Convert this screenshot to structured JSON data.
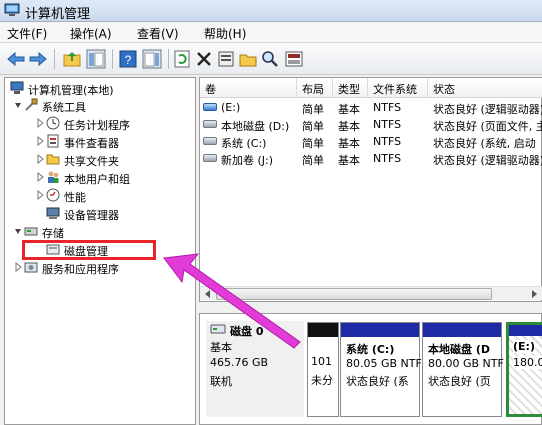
{
  "window": {
    "title": "计算机管理"
  },
  "menu": [
    "文件(F)",
    "操作(A)",
    "查看(V)",
    "帮助(H)"
  ],
  "toolbar": {
    "icons": [
      "back-icon",
      "forward-icon",
      "up-folder-icon",
      "show-tree-icon",
      "help-icon",
      "action-pane-icon",
      "refresh-icon",
      "delete-icon",
      "properties-icon",
      "open-icon",
      "search-icon",
      "disk-properties-icon"
    ]
  },
  "tree": {
    "root": "计算机管理(本地)",
    "system_tools": "系统工具",
    "task_scheduler": "任务计划程序",
    "event_viewer": "事件查看器",
    "shared_folders": "共享文件夹",
    "local_users": "本地用户和组",
    "performance": "性能",
    "device_manager": "设备管理器",
    "storage": "存储",
    "disk_management": "磁盘管理",
    "services_apps": "服务和应用程序"
  },
  "volumes": {
    "columns": [
      "卷",
      "布局",
      "类型",
      "文件系统",
      "状态"
    ],
    "rows": [
      {
        "volume": "(E:)",
        "layout": "简单",
        "type": "基本",
        "fs": "NTFS",
        "status": "状态良好 (逻辑驱动器)"
      },
      {
        "volume": "本地磁盘 (D:)",
        "layout": "简单",
        "type": "基本",
        "fs": "NTFS",
        "status": "状态良好 (页面文件, 主"
      },
      {
        "volume": "系统 (C:)",
        "layout": "简单",
        "type": "基本",
        "fs": "NTFS",
        "status": "状态良好 (系统, 启动"
      },
      {
        "volume": "新加卷 (J:)",
        "layout": "简单",
        "type": "基本",
        "fs": "NTFS",
        "status": "状态良好 (逻辑驱动器)"
      }
    ]
  },
  "disk": {
    "name": "磁盘 0",
    "type": "基本",
    "size": "465.76 GB",
    "state": "联机",
    "partitions": [
      {
        "line1": "101",
        "line2": "未分"
      },
      {
        "name": "系统 (C:)",
        "size": "80.05 GB NTF",
        "status": "状态良好 (系"
      },
      {
        "name": "本地磁盘 (D",
        "size": "80.00 GB NTF",
        "status": "状态良好 (页"
      },
      {
        "name": "(E:)",
        "size": "180.0"
      }
    ]
  },
  "colors": {
    "partition_bar": "#1e2aa6",
    "highlight": "#e8232a",
    "arrow": "#e23bd8",
    "selected_partition": "#2e8b3a"
  }
}
